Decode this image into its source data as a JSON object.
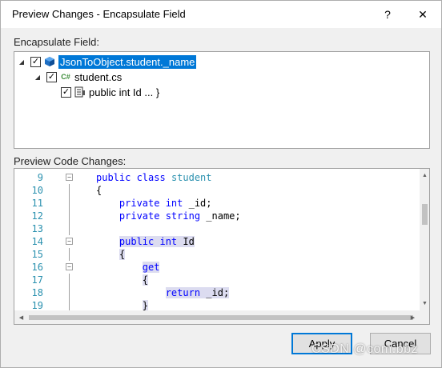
{
  "window": {
    "title": "Preview Changes - Encapsulate Field",
    "help_glyph": "?",
    "close_glyph": "✕"
  },
  "encapsulate": {
    "label": "Encapsulate Field:",
    "tree": [
      {
        "label": "JsonToObject.student._name",
        "checked": true,
        "expanded": true,
        "selected": true,
        "icon": "field-cube-icon"
      },
      {
        "label": "student.cs",
        "checked": true,
        "expanded": true,
        "selected": false,
        "icon": "csharp-file-icon",
        "icon_text": "C#"
      },
      {
        "label": "public int Id ... }",
        "checked": true,
        "selected": false,
        "icon": "property-icon"
      }
    ]
  },
  "preview": {
    "label": "Preview Code Changes:",
    "lines": [
      {
        "num": "9",
        "fold": "−",
        "tokens": [
          {
            "t": "public ",
            "c": "kw"
          },
          {
            "t": "class ",
            "c": "kw"
          },
          {
            "t": "student",
            "c": "ty"
          }
        ]
      },
      {
        "num": "10",
        "fold": "",
        "tokens": [
          {
            "t": "{",
            "c": "tx"
          }
        ]
      },
      {
        "num": "11",
        "fold": "",
        "tokens": [
          {
            "t": "    ",
            "c": "tx"
          },
          {
            "t": "private ",
            "c": "kw"
          },
          {
            "t": "int ",
            "c": "kw"
          },
          {
            "t": "_id;",
            "c": "tx"
          }
        ]
      },
      {
        "num": "12",
        "fold": "",
        "tokens": [
          {
            "t": "    ",
            "c": "tx"
          },
          {
            "t": "private ",
            "c": "kw"
          },
          {
            "t": "string ",
            "c": "kw"
          },
          {
            "t": "_name;",
            "c": "tx"
          }
        ]
      },
      {
        "num": "13",
        "fold": "",
        "tokens": []
      },
      {
        "num": "14",
        "fold": "−",
        "tokens": [
          {
            "t": "    ",
            "c": "tx"
          },
          {
            "t": "public int ",
            "c": "kw",
            "h": true
          },
          {
            "t": "Id",
            "c": "tx",
            "h": true
          }
        ]
      },
      {
        "num": "15",
        "fold": "",
        "tokens": [
          {
            "t": "    ",
            "c": "tx"
          },
          {
            "t": "{",
            "c": "tx",
            "h": true
          }
        ]
      },
      {
        "num": "16",
        "fold": "−",
        "tokens": [
          {
            "t": "        ",
            "c": "tx"
          },
          {
            "t": "get",
            "c": "kw",
            "h": true
          }
        ]
      },
      {
        "num": "17",
        "fold": "",
        "tokens": [
          {
            "t": "        ",
            "c": "tx"
          },
          {
            "t": "{",
            "c": "tx",
            "h": true
          }
        ]
      },
      {
        "num": "18",
        "fold": "",
        "tokens": [
          {
            "t": "            ",
            "c": "tx"
          },
          {
            "t": "return ",
            "c": "kw",
            "h": true
          },
          {
            "t": "_id;",
            "c": "tx",
            "h": true
          }
        ]
      },
      {
        "num": "19",
        "fold": "",
        "tokens": [
          {
            "t": "        ",
            "c": "tx"
          },
          {
            "t": "}",
            "c": "tx",
            "h": true
          }
        ]
      }
    ]
  },
  "buttons": {
    "apply": "Apply",
    "cancel": "Cancel"
  },
  "watermark": "CSDN @com.bbz",
  "colors": {
    "selection": "#0078d7",
    "keyword": "#0000ff",
    "type": "#2b91af",
    "line_number": "#2b91af",
    "highlight": "#dcdcf0"
  }
}
